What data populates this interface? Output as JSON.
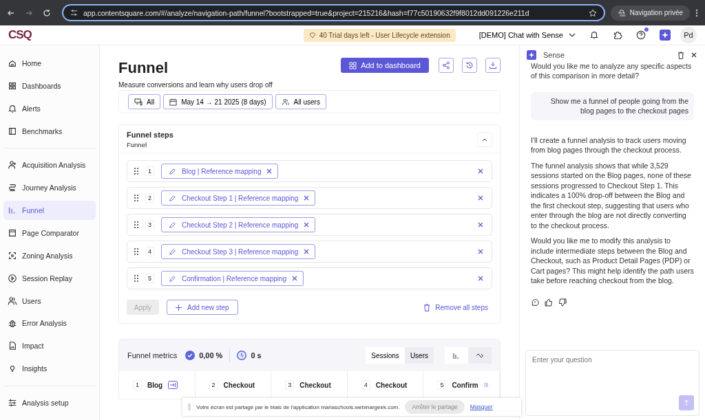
{
  "browser": {
    "url": "app.contentsquare.com/#/analyze/navigation-path/funnel?bootstrapped=true&project=215216&hash=f77c50190632f9f8012dd091226e211d",
    "private_label": "Navigation privée"
  },
  "header": {
    "logo": "CSQ",
    "trial": "40 Trial days left - User Lifecycle extension",
    "project": "[DEMO] Chat with Sense",
    "avatar": "Pd",
    "notification_dot": true
  },
  "sidebar": {
    "items": [
      {
        "label": "Home",
        "selected": false
      },
      {
        "label": "Dashboards",
        "selected": false
      },
      {
        "label": "Alerts",
        "selected": false
      },
      {
        "label": "Benchmarks",
        "selected": false
      },
      {
        "label": "Acquisition Analysis",
        "selected": false
      },
      {
        "label": "Journey Analysis",
        "selected": false
      },
      {
        "label": "Funnel",
        "selected": true
      },
      {
        "label": "Page Comparator",
        "selected": false
      },
      {
        "label": "Zoning Analysis",
        "selected": false
      },
      {
        "label": "Session Replay",
        "selected": false
      },
      {
        "label": "Users",
        "selected": false
      },
      {
        "label": "Error Analysis",
        "selected": false
      },
      {
        "label": "Impact",
        "selected": false
      },
      {
        "label": "Insights",
        "selected": false
      }
    ],
    "footer": "Analysis setup"
  },
  "page": {
    "title": "Funnel",
    "subtitle": "Measure conversions and learn why users drop off",
    "add_button": "Add to dashboard",
    "filters": [
      "All",
      "May 14 → 21 2025 (8 days)",
      "All users"
    ]
  },
  "steps_card": {
    "title": "Funnel steps",
    "subtitle": "Funnel",
    "steps": [
      {
        "number": "1",
        "label": "Blog | Reference mapping"
      },
      {
        "number": "2",
        "label": "Checkout Step 1 | Reference mapping"
      },
      {
        "number": "3",
        "label": "Checkout Step 2 | Reference mapping"
      },
      {
        "number": "4",
        "label": "Checkout Step 3 | Reference mapping"
      },
      {
        "number": "5",
        "label": "Confirmation | Reference mapping"
      }
    ],
    "apply": "Apply",
    "apply_disabled": true,
    "add_step": "Add new step",
    "remove_all": "Remove all steps"
  },
  "metrics": {
    "title": "Funnel metrics",
    "conversion": "0,00 %",
    "duration": "0 s",
    "toggles": [
      {
        "label": "Sessions",
        "selected": true
      },
      {
        "label": "Users",
        "selected": false
      }
    ],
    "views": [
      {
        "kind": "bars",
        "selected": true
      },
      {
        "kind": "trend",
        "selected": false
      }
    ],
    "columns": [
      {
        "number": "1",
        "label": "Blog"
      },
      {
        "number": "2",
        "label": "Checkout"
      },
      {
        "number": "3",
        "label": "Checkout"
      },
      {
        "number": "4",
        "label": "Checkout"
      },
      {
        "number": "5",
        "label": "Confirm"
      }
    ]
  },
  "share_bar": {
    "message": "Votre écran est partagé par le biais de l'application mariaschools.webinargeek.com.",
    "stop": "Arrêter le partage",
    "hide": "Masquer"
  },
  "chat": {
    "title": "Sense",
    "messages": [
      {
        "kind": "assistant",
        "paragraphs": [
          "Would you like me to analyze any specific aspects of this comparison in more detail?"
        ]
      },
      {
        "kind": "user",
        "paragraphs": [
          "Show me a funnel of people going from the blog pages to the checkout pages"
        ]
      },
      {
        "kind": "assistant",
        "paragraphs": [
          "I'll create a funnel analysis to track users moving from blog pages through the checkout process.",
          "The funnel analysis shows that while 3,529 sessions started on the Blog pages, none of these sessions progressed to Checkout Step 1. This indicates a 100% drop-off between the Blog and the first checkout step, suggesting that users who enter through the blog are not directly converting to the checkout process.",
          "Would you like me to modify this analysis to include intermediate steps between the Blog and Checkout, such as Product Detail Pages (PDP) or Cart pages? This might help identify the path users take before reaching checkout from the blog."
        ]
      }
    ],
    "placeholder": "Enter your question"
  }
}
